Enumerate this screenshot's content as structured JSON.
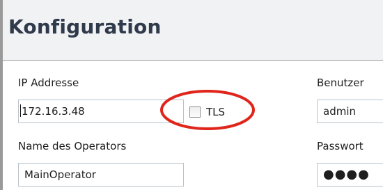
{
  "header": {
    "title": "Konfiguration"
  },
  "form": {
    "ip_label": "IP Addresse",
    "ip_value": "172.16.3.48",
    "tls_label": "TLS",
    "tls_checked": false,
    "operator_label": "Name des Operators",
    "operator_value": "MainOperator",
    "user_label": "Benutzer",
    "user_value": "admin",
    "password_label": "Passwort",
    "password_value": "●●●●"
  },
  "annotation": {
    "color": "#e0251b",
    "icon": "highlight-ellipse"
  },
  "colors": {
    "header_bg": "#f1f2f4",
    "title": "#2f3a4b",
    "field_border": "#b9c2cc"
  }
}
